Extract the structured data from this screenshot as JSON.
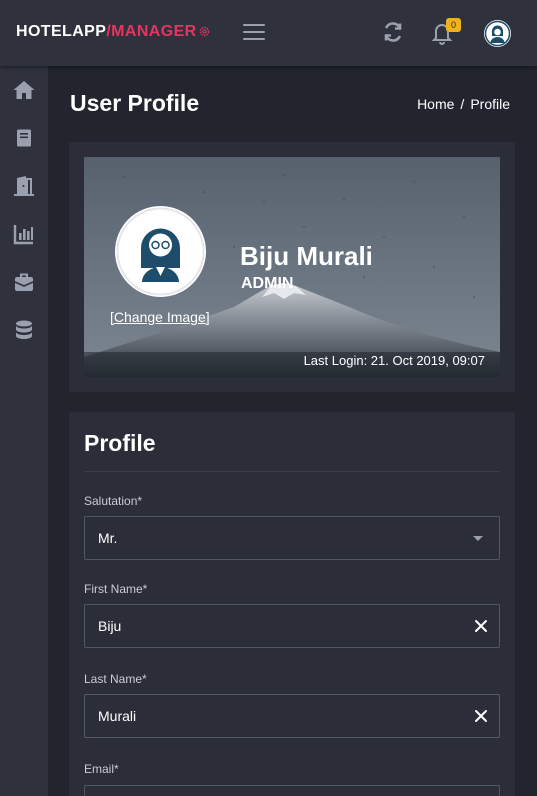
{
  "header": {
    "brand_part1": "HOTELAPP",
    "brand_part2": "/MANAGER",
    "notification_count": "0",
    "icons": [
      "menu-icon",
      "refresh-icon",
      "bell-icon",
      "user-avatar"
    ]
  },
  "sidebar": {
    "items": [
      "home-icon",
      "book-icon",
      "door-icon",
      "chart-icon",
      "briefcase-icon",
      "database-icon"
    ]
  },
  "page": {
    "title": "User Profile",
    "breadcrumb": {
      "home": "Home",
      "separator": "/",
      "current": "Profile"
    }
  },
  "profile_header": {
    "name": "Biju Murali",
    "role": "ADMIN",
    "avatar_label": "ADMIN",
    "change_image": "[Change Image]",
    "last_login": "Last Login: 21. Oct 2019, 09:07"
  },
  "form": {
    "section_title": "Profile",
    "fields": {
      "salutation": {
        "label": "Salutation*",
        "value": "Mr."
      },
      "first_name": {
        "label": "First Name*",
        "value": "Biju"
      },
      "last_name": {
        "label": "Last Name*",
        "value": "Murali"
      },
      "email": {
        "label": "Email*",
        "value": ""
      }
    }
  },
  "colors": {
    "background": "#22252e",
    "panel": "#2b2e38",
    "topbar": "#2f323d",
    "accent": "#e8335e",
    "badge": "#f0b21c"
  }
}
